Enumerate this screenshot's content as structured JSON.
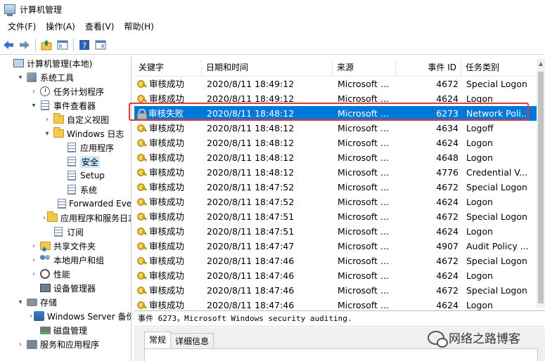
{
  "window": {
    "title": "计算机管理"
  },
  "menu": [
    "文件(F)",
    "操作(A)",
    "查看(V)",
    "帮助(H)"
  ],
  "tree": [
    {
      "label": "计算机管理(本地)",
      "indent": 0,
      "arrow": "",
      "icon": "computer-icon"
    },
    {
      "label": "系统工具",
      "indent": 1,
      "arrow": "▾",
      "icon": "tools-icon"
    },
    {
      "label": "任务计划程序",
      "indent": 2,
      "arrow": "›",
      "icon": "clock-icon"
    },
    {
      "label": "事件查看器",
      "indent": 2,
      "arrow": "▾",
      "icon": "log-icon"
    },
    {
      "label": "自定义视图",
      "indent": 3,
      "arrow": "›",
      "icon": "folder-icon"
    },
    {
      "label": "Windows 日志",
      "indent": 3,
      "arrow": "▾",
      "icon": "folder-icon"
    },
    {
      "label": "应用程序",
      "indent": 4,
      "arrow": "",
      "icon": "log-icon"
    },
    {
      "label": "安全",
      "indent": 4,
      "arrow": "",
      "icon": "log-icon",
      "selected": true
    },
    {
      "label": "Setup",
      "indent": 4,
      "arrow": "",
      "icon": "log-icon"
    },
    {
      "label": "系统",
      "indent": 4,
      "arrow": "",
      "icon": "log-icon"
    },
    {
      "label": "Forwarded Eve",
      "indent": 4,
      "arrow": "",
      "icon": "log-icon"
    },
    {
      "label": "应用程序和服务日志",
      "indent": 3,
      "arrow": "›",
      "icon": "folder-icon"
    },
    {
      "label": "订阅",
      "indent": 3,
      "arrow": "",
      "icon": "log-icon"
    },
    {
      "label": "共享文件夹",
      "indent": 2,
      "arrow": "›",
      "icon": "share-icon"
    },
    {
      "label": "本地用户和组",
      "indent": 2,
      "arrow": "›",
      "icon": "users-icon"
    },
    {
      "label": "性能",
      "indent": 2,
      "arrow": "›",
      "icon": "performance-icon"
    },
    {
      "label": "设备管理器",
      "indent": 2,
      "arrow": "",
      "icon": "device-icon"
    },
    {
      "label": "存储",
      "indent": 1,
      "arrow": "▾",
      "icon": "storage-icon"
    },
    {
      "label": "Windows Server 备份",
      "indent": 2,
      "arrow": "›",
      "icon": "server-backup-icon"
    },
    {
      "label": "磁盘管理",
      "indent": 2,
      "arrow": "",
      "icon": "disk-icon"
    },
    {
      "label": "服务和应用程序",
      "indent": 1,
      "arrow": "›",
      "icon": "services-icon"
    }
  ],
  "columns": [
    "关键字",
    "日期和时间",
    "来源",
    "事件 ID",
    "任务类别"
  ],
  "events": [
    {
      "keyword": "审核成功",
      "datetime": "2020/8/11 18:49:12",
      "source": "Microsoft W...",
      "id": "4672",
      "category": "Special Logon"
    },
    {
      "keyword": "审核成功",
      "datetime": "2020/8/11 18:49:12",
      "source": "Microsoft W...",
      "id": "4624",
      "category": "Logon"
    },
    {
      "keyword": "审核失败",
      "datetime": "2020/8/11 18:48:12",
      "source": "Microsoft W...",
      "id": "6273",
      "category": "Network Poli...",
      "selected": true
    },
    {
      "keyword": "审核成功",
      "datetime": "2020/8/11 18:48:12",
      "source": "Microsoft W...",
      "id": "4634",
      "category": "Logoff"
    },
    {
      "keyword": "审核成功",
      "datetime": "2020/8/11 18:48:12",
      "source": "Microsoft W...",
      "id": "4624",
      "category": "Logon"
    },
    {
      "keyword": "审核成功",
      "datetime": "2020/8/11 18:48:12",
      "source": "Microsoft W...",
      "id": "4648",
      "category": "Logon"
    },
    {
      "keyword": "审核成功",
      "datetime": "2020/8/11 18:48:12",
      "source": "Microsoft W...",
      "id": "4776",
      "category": "Credential V..."
    },
    {
      "keyword": "审核成功",
      "datetime": "2020/8/11 18:47:52",
      "source": "Microsoft W...",
      "id": "4672",
      "category": "Special Logon"
    },
    {
      "keyword": "审核成功",
      "datetime": "2020/8/11 18:47:52",
      "source": "Microsoft W...",
      "id": "4624",
      "category": "Logon"
    },
    {
      "keyword": "审核成功",
      "datetime": "2020/8/11 18:47:51",
      "source": "Microsoft W...",
      "id": "4672",
      "category": "Special Logon"
    },
    {
      "keyword": "审核成功",
      "datetime": "2020/8/11 18:47:51",
      "source": "Microsoft W...",
      "id": "4624",
      "category": "Logon"
    },
    {
      "keyword": "审核成功",
      "datetime": "2020/8/11 18:47:47",
      "source": "Microsoft W...",
      "id": "4907",
      "category": "Audit Policy ..."
    },
    {
      "keyword": "审核成功",
      "datetime": "2020/8/11 18:47:46",
      "source": "Microsoft W...",
      "id": "4672",
      "category": "Special Logon"
    },
    {
      "keyword": "审核成功",
      "datetime": "2020/8/11 18:47:46",
      "source": "Microsoft W...",
      "id": "4624",
      "category": "Logon"
    },
    {
      "keyword": "审核成功",
      "datetime": "2020/8/11 18:47:46",
      "source": "Microsoft W...",
      "id": "4672",
      "category": "Special Logon"
    },
    {
      "keyword": "审核成功",
      "datetime": "2020/8/11 18:47:46",
      "source": "Microsoft W...",
      "id": "4624",
      "category": "Logon"
    }
  ],
  "detail": {
    "title": "事件 6273，Microsoft Windows security auditing.",
    "tabs": [
      "常规",
      "详细信息"
    ]
  },
  "watermark": "网络之路博客",
  "colors": {
    "selection": "#0078d7",
    "highlight_box": "#e03a3a",
    "tree_selected": "#cce8ff"
  }
}
